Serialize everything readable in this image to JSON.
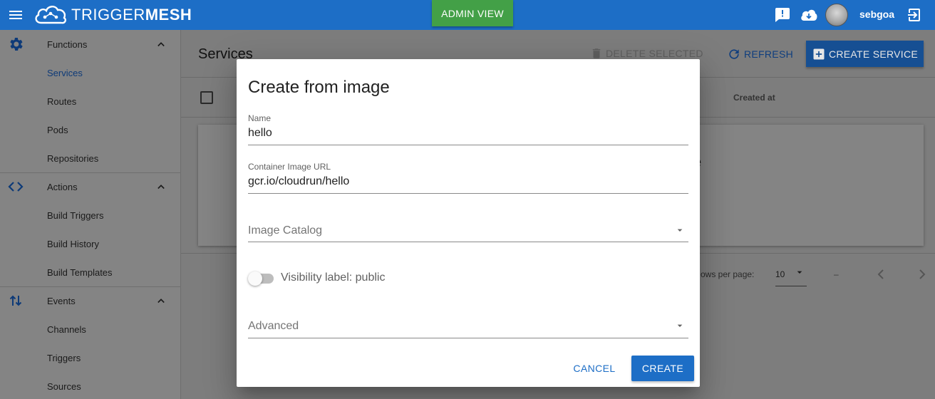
{
  "topbar": {
    "logo_light": "TRIGGER",
    "logo_bold": "MESH",
    "admin_view_label": "ADMIN VIEW",
    "username": "sebgoa",
    "icons": [
      "menu-icon",
      "feedback-icon",
      "cloud-download-icon",
      "exit-icon"
    ],
    "color": "#1d6ec6"
  },
  "sidebar": {
    "sections": [
      {
        "label": "Functions",
        "icon": "gear-icon",
        "items": [
          "Services",
          "Routes",
          "Pods",
          "Repositories"
        ]
      },
      {
        "label": "Actions",
        "icon": "code-icon",
        "items": [
          "Build Triggers",
          "Build History",
          "Build Templates"
        ]
      },
      {
        "label": "Events",
        "icon": "swap-vert-icon",
        "items": [
          "Channels",
          "Triggers",
          "Sources"
        ]
      }
    ],
    "active_item": "Services"
  },
  "main": {
    "title": "Services",
    "delete_selected_label": "DELETE SELECTED",
    "refresh_label": "REFRESH",
    "create_service_label": "CREATE SERVICE",
    "column_created_at": "Created at",
    "card_partial_text": "e",
    "rows_per_page_label": "ows per page:",
    "rows_per_page_value": "10",
    "range_text": "–"
  },
  "dialog": {
    "title": "Create from image",
    "name_label": "Name",
    "name_value": "hello",
    "image_url_label": "Container Image URL",
    "image_url_value": "gcr.io/cloudrun/hello",
    "image_catalog_placeholder": "Image Catalog",
    "visibility_label": "Visibility label: public",
    "visibility_on": false,
    "advanced_placeholder": "Advanced",
    "cancel_label": "CANCEL",
    "create_label": "CREATE"
  }
}
